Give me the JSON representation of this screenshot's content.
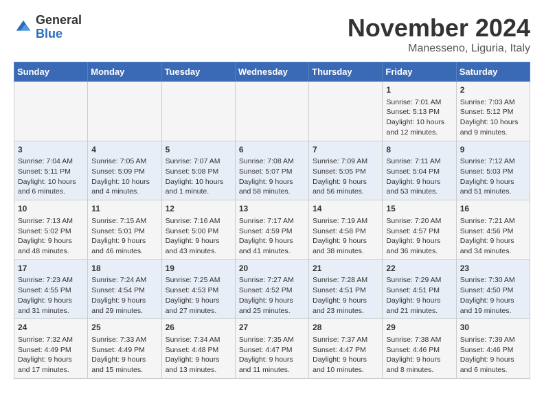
{
  "header": {
    "logo_general": "General",
    "logo_blue": "Blue",
    "month_title": "November 2024",
    "location": "Manesseno, Liguria, Italy"
  },
  "weekdays": [
    "Sunday",
    "Monday",
    "Tuesday",
    "Wednesday",
    "Thursday",
    "Friday",
    "Saturday"
  ],
  "weeks": [
    [
      {
        "day": "",
        "info": ""
      },
      {
        "day": "",
        "info": ""
      },
      {
        "day": "",
        "info": ""
      },
      {
        "day": "",
        "info": ""
      },
      {
        "day": "",
        "info": ""
      },
      {
        "day": "1",
        "info": "Sunrise: 7:01 AM\nSunset: 5:13 PM\nDaylight: 10 hours and 12 minutes."
      },
      {
        "day": "2",
        "info": "Sunrise: 7:03 AM\nSunset: 5:12 PM\nDaylight: 10 hours and 9 minutes."
      }
    ],
    [
      {
        "day": "3",
        "info": "Sunrise: 7:04 AM\nSunset: 5:11 PM\nDaylight: 10 hours and 6 minutes."
      },
      {
        "day": "4",
        "info": "Sunrise: 7:05 AM\nSunset: 5:09 PM\nDaylight: 10 hours and 4 minutes."
      },
      {
        "day": "5",
        "info": "Sunrise: 7:07 AM\nSunset: 5:08 PM\nDaylight: 10 hours and 1 minute."
      },
      {
        "day": "6",
        "info": "Sunrise: 7:08 AM\nSunset: 5:07 PM\nDaylight: 9 hours and 58 minutes."
      },
      {
        "day": "7",
        "info": "Sunrise: 7:09 AM\nSunset: 5:05 PM\nDaylight: 9 hours and 56 minutes."
      },
      {
        "day": "8",
        "info": "Sunrise: 7:11 AM\nSunset: 5:04 PM\nDaylight: 9 hours and 53 minutes."
      },
      {
        "day": "9",
        "info": "Sunrise: 7:12 AM\nSunset: 5:03 PM\nDaylight: 9 hours and 51 minutes."
      }
    ],
    [
      {
        "day": "10",
        "info": "Sunrise: 7:13 AM\nSunset: 5:02 PM\nDaylight: 9 hours and 48 minutes."
      },
      {
        "day": "11",
        "info": "Sunrise: 7:15 AM\nSunset: 5:01 PM\nDaylight: 9 hours and 46 minutes."
      },
      {
        "day": "12",
        "info": "Sunrise: 7:16 AM\nSunset: 5:00 PM\nDaylight: 9 hours and 43 minutes."
      },
      {
        "day": "13",
        "info": "Sunrise: 7:17 AM\nSunset: 4:59 PM\nDaylight: 9 hours and 41 minutes."
      },
      {
        "day": "14",
        "info": "Sunrise: 7:19 AM\nSunset: 4:58 PM\nDaylight: 9 hours and 38 minutes."
      },
      {
        "day": "15",
        "info": "Sunrise: 7:20 AM\nSunset: 4:57 PM\nDaylight: 9 hours and 36 minutes."
      },
      {
        "day": "16",
        "info": "Sunrise: 7:21 AM\nSunset: 4:56 PM\nDaylight: 9 hours and 34 minutes."
      }
    ],
    [
      {
        "day": "17",
        "info": "Sunrise: 7:23 AM\nSunset: 4:55 PM\nDaylight: 9 hours and 31 minutes."
      },
      {
        "day": "18",
        "info": "Sunrise: 7:24 AM\nSunset: 4:54 PM\nDaylight: 9 hours and 29 minutes."
      },
      {
        "day": "19",
        "info": "Sunrise: 7:25 AM\nSunset: 4:53 PM\nDaylight: 9 hours and 27 minutes."
      },
      {
        "day": "20",
        "info": "Sunrise: 7:27 AM\nSunset: 4:52 PM\nDaylight: 9 hours and 25 minutes."
      },
      {
        "day": "21",
        "info": "Sunrise: 7:28 AM\nSunset: 4:51 PM\nDaylight: 9 hours and 23 minutes."
      },
      {
        "day": "22",
        "info": "Sunrise: 7:29 AM\nSunset: 4:51 PM\nDaylight: 9 hours and 21 minutes."
      },
      {
        "day": "23",
        "info": "Sunrise: 7:30 AM\nSunset: 4:50 PM\nDaylight: 9 hours and 19 minutes."
      }
    ],
    [
      {
        "day": "24",
        "info": "Sunrise: 7:32 AM\nSunset: 4:49 PM\nDaylight: 9 hours and 17 minutes."
      },
      {
        "day": "25",
        "info": "Sunrise: 7:33 AM\nSunset: 4:49 PM\nDaylight: 9 hours and 15 minutes."
      },
      {
        "day": "26",
        "info": "Sunrise: 7:34 AM\nSunset: 4:48 PM\nDaylight: 9 hours and 13 minutes."
      },
      {
        "day": "27",
        "info": "Sunrise: 7:35 AM\nSunset: 4:47 PM\nDaylight: 9 hours and 11 minutes."
      },
      {
        "day": "28",
        "info": "Sunrise: 7:37 AM\nSunset: 4:47 PM\nDaylight: 9 hours and 10 minutes."
      },
      {
        "day": "29",
        "info": "Sunrise: 7:38 AM\nSunset: 4:46 PM\nDaylight: 9 hours and 8 minutes."
      },
      {
        "day": "30",
        "info": "Sunrise: 7:39 AM\nSunset: 4:46 PM\nDaylight: 9 hours and 6 minutes."
      }
    ]
  ]
}
